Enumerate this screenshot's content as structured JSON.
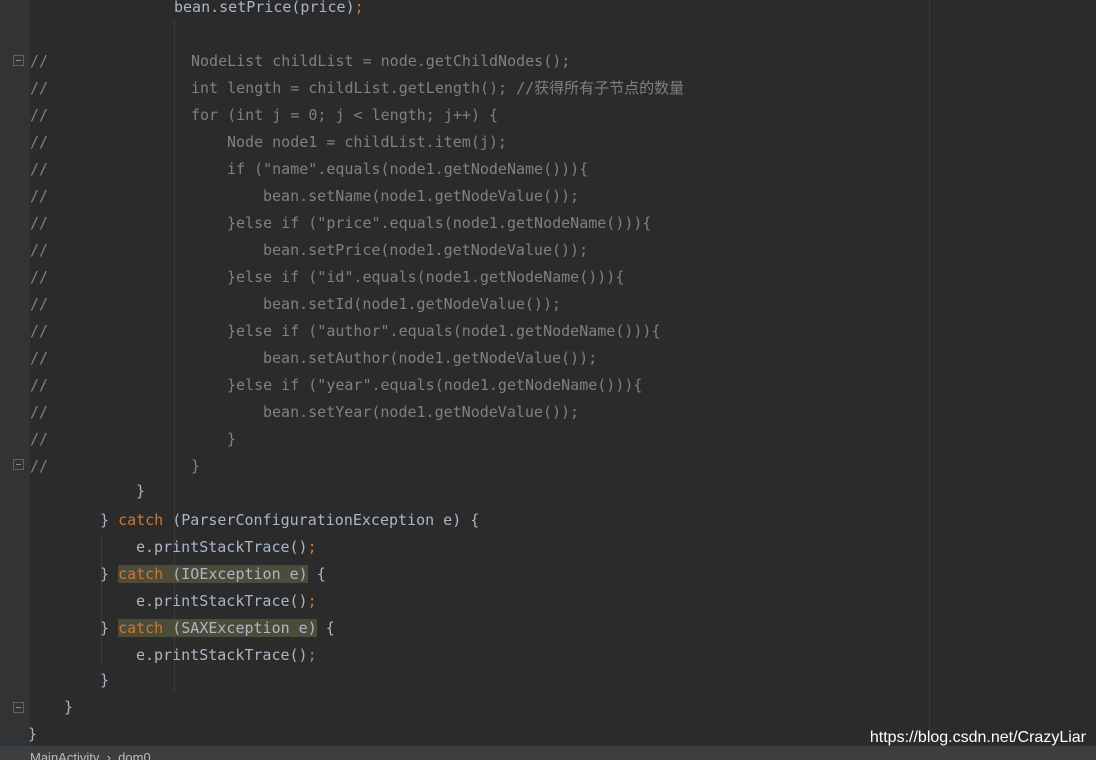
{
  "editor": {
    "lines": [
      {
        "text": "bean.setPrice(price)",
        "semi": ";",
        "commented": false
      },
      {
        "text": "NodeList childList = node.getChildNodes();",
        "commented": true
      },
      {
        "text": "int length = childList.getLength(); //获得所有子节点的数量",
        "commented": true
      },
      {
        "text": "for (int j = 0; j < length; j++) {",
        "commented": true
      },
      {
        "text": "Node node1 = childList.item(j);",
        "commented": true
      },
      {
        "text": "if (\"name\".equals(node1.getNodeName())){",
        "commented": true
      },
      {
        "text": "bean.setName(node1.getNodeValue());",
        "commented": true
      },
      {
        "text": "}else if (\"price\".equals(node1.getNodeName())){",
        "commented": true
      },
      {
        "text": "bean.setPrice(node1.getNodeValue());",
        "commented": true
      },
      {
        "text": "}else if (\"id\".equals(node1.getNodeName())){",
        "commented": true
      },
      {
        "text": "bean.setId(node1.getNodeValue());",
        "commented": true
      },
      {
        "text": "}else if (\"author\".equals(node1.getNodeName())){",
        "commented": true
      },
      {
        "text": "bean.setAuthor(node1.getNodeValue());",
        "commented": true
      },
      {
        "text": "}else if (\"year\".equals(node1.getNodeName())){",
        "commented": true
      },
      {
        "text": "bean.setYear(node1.getNodeValue());",
        "commented": true
      },
      {
        "text": "}",
        "commented": true
      },
      {
        "text": "}",
        "commented": true
      },
      {
        "text": "}"
      },
      {
        "pre": "} ",
        "kw": "catch",
        "post": " (ParserConfigurationException e) {"
      },
      {
        "text": "e.printStackTrace()",
        "semi": ";"
      },
      {
        "pre": "} ",
        "kw": "catch",
        "post": " (IOException e)",
        "tail": " {"
      },
      {
        "text": "e.printStackTrace()",
        "semi": ";"
      },
      {
        "pre": "} ",
        "kw": "catch",
        "post": " (SAXException e)",
        "tail": " {"
      },
      {
        "text": "e.printStackTrace()",
        "semi": ";"
      },
      {
        "text": "}"
      },
      {
        "text": "}"
      },
      {
        "text": "}"
      }
    ],
    "comment_prefix": "//"
  },
  "statusbar": {
    "breadcrumb_1": "MainActivity",
    "breadcrumb_sep": "›",
    "breadcrumb_2": "dom0"
  },
  "watermark": "https://blog.csdn.net/CrazyLiar"
}
